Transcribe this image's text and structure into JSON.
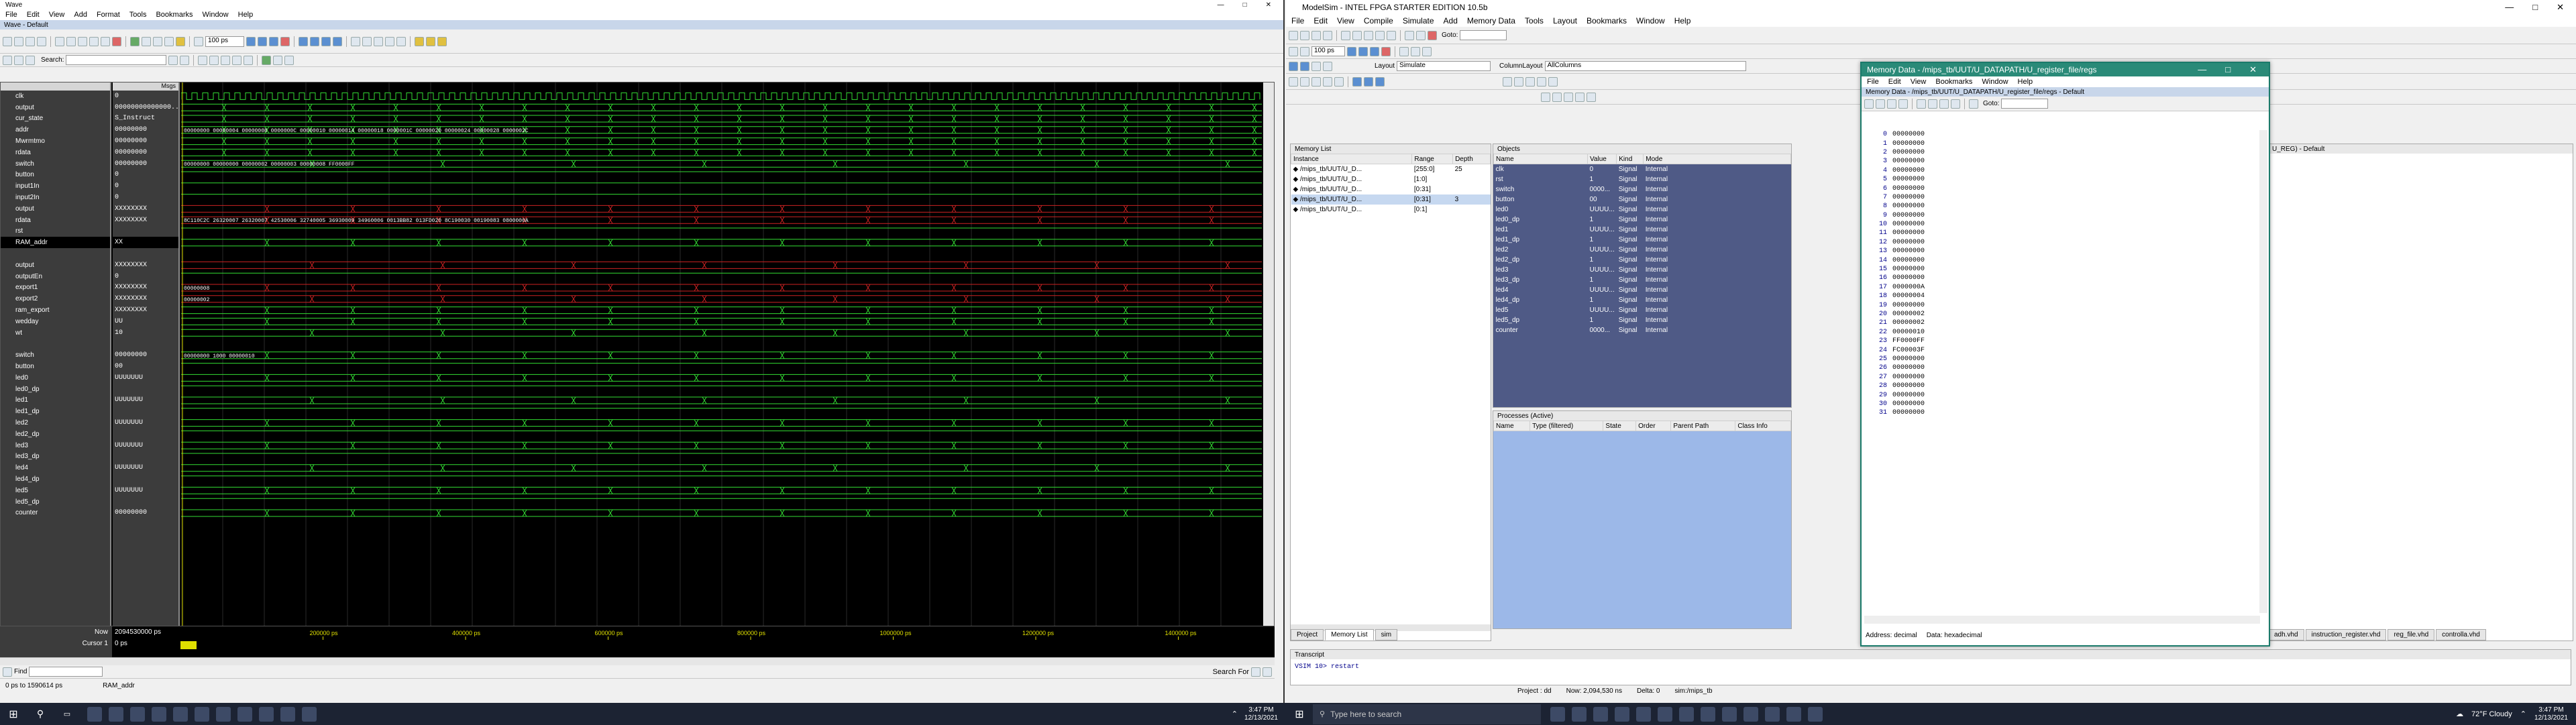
{
  "wave_window": {
    "title": "Wave",
    "subtitle": "Wave - Default",
    "menu": [
      "File",
      "Edit",
      "View",
      "Add",
      "Format",
      "Tools",
      "Bookmarks",
      "Window",
      "Help"
    ],
    "zoom_value": "100 ps",
    "search_label": "Search:",
    "msgs_header": "Msgs",
    "signals": [
      {
        "name": "clk",
        "value": "0"
      },
      {
        "name": "output",
        "value": "00000000000000..."
      },
      {
        "name": "cur_state",
        "value": "S_Instruct"
      },
      {
        "name": "addr",
        "value": "00000000"
      },
      {
        "name": "Mwrmtmo",
        "value": "00000000"
      },
      {
        "name": "rdata",
        "value": "00000000"
      },
      {
        "name": "switch",
        "value": "00000000"
      },
      {
        "name": "button",
        "value": "0"
      },
      {
        "name": "input1In",
        "value": "0"
      },
      {
        "name": "input2In",
        "value": "0"
      },
      {
        "name": "output",
        "value": "XXXXXXXX"
      },
      {
        "name": "rdata",
        "value": "XXXXXXXX"
      },
      {
        "name": "rst",
        "value": ""
      },
      {
        "name": "RAM_addr",
        "value": "XX"
      },
      {
        "name": "",
        "value": ""
      },
      {
        "name": "output",
        "value": "XXXXXXXX"
      },
      {
        "name": "outputEn",
        "value": "0"
      },
      {
        "name": "export1",
        "value": "XXXXXXXX"
      },
      {
        "name": "export2",
        "value": "XXXXXXXX"
      },
      {
        "name": "ram_export",
        "value": "XXXXXXXX"
      },
      {
        "name": "wedday",
        "value": "UU"
      },
      {
        "name": "wt",
        "value": "10"
      },
      {
        "name": "",
        "value": ""
      },
      {
        "name": "switch",
        "value": "00000000"
      },
      {
        "name": "button",
        "value": "00"
      },
      {
        "name": "led0",
        "value": "UUUUUUU"
      },
      {
        "name": "led0_dp",
        "value": ""
      },
      {
        "name": "led1",
        "value": "UUUUUUU"
      },
      {
        "name": "led1_dp",
        "value": ""
      },
      {
        "name": "led2",
        "value": "UUUUUUU"
      },
      {
        "name": "led2_dp",
        "value": ""
      },
      {
        "name": "led3",
        "value": "UUUUUUU"
      },
      {
        "name": "led3_dp",
        "value": ""
      },
      {
        "name": "led4",
        "value": "UUUUUUU"
      },
      {
        "name": "led4_dp",
        "value": ""
      },
      {
        "name": "led5",
        "value": "UUUUUUU"
      },
      {
        "name": "led5_dp",
        "value": ""
      },
      {
        "name": "counter",
        "value": "00000000"
      }
    ],
    "now_label": "Now",
    "now_value": "2094530000 ps",
    "cursor_label": "Cursor 1",
    "cursor_value": "0 ps",
    "timeline_labels": [
      "200000 ps",
      "400000 ps",
      "600000 ps",
      "800000 ps",
      "1000000 ps",
      "1200000 ps",
      "1400000 ps"
    ],
    "wave_texts": [
      "00000000  00000004  00000008  0000000C  00000010  00000014  00000018  0000001C  00000020  00000024  00000028  0000002C",
      "00000000  00000000  00000002  00000003  00000008  FF0000FF",
      "8C110C2C  26320007  26320007  42530006  32740005  36930009  34960006  0013BB82  013FD020  8C190030  00190083  0800000A",
      "00000008",
      "00000002",
      "00000000 1000  00000010"
    ],
    "find_label": "Find",
    "open_label": "Open",
    "search_for_label": "Search For",
    "status_range": "0 ps to 1590614 ps",
    "status_signal": "RAM_addr"
  },
  "modelsim": {
    "title": "ModelSim - INTEL FPGA STARTER EDITION 10.5b",
    "menu": [
      "File",
      "Edit",
      "View",
      "Compile",
      "Simulate",
      "Add",
      "Memory Data",
      "Tools",
      "Layout",
      "Bookmarks",
      "Window",
      "Help"
    ],
    "goto_label": "Goto:",
    "zoom_value": "100 ps",
    "layout_label": "Layout",
    "layout_value": "Simulate",
    "column_layout_label": "ColumnLayout",
    "column_layout_value": "AllColumns",
    "memory_list": {
      "title": "Memory List",
      "headers": [
        "Instance",
        "Range",
        "Depth"
      ],
      "rows": [
        {
          "instance": "/mips_tb/UUT/U_D...",
          "range": "[255:0]",
          "depth": "25"
        },
        {
          "instance": "/mips_tb/UUT/U_D...",
          "range": "[1:0]",
          "depth": ""
        },
        {
          "instance": "/mips_tb/UUT/U_D...",
          "range": "[0:31]",
          "depth": ""
        },
        {
          "instance": "/mips_tb/UUT/U_D...",
          "range": "[0:31]",
          "depth": "3"
        },
        {
          "instance": "/mips_tb/UUT/U_D...",
          "range": "[0:1]",
          "depth": ""
        }
      ],
      "tabs": [
        "Project",
        "Memory List",
        "sim"
      ]
    },
    "objects": {
      "title": "Objects",
      "headers": [
        "Name",
        "Value",
        "Kind",
        "Mode"
      ],
      "rows": [
        {
          "name": "clk",
          "value": "0",
          "kind": "Signal",
          "mode": "Internal"
        },
        {
          "name": "rst",
          "value": "1",
          "kind": "Signal",
          "mode": "Internal"
        },
        {
          "name": "switch",
          "value": "0000...",
          "kind": "Signal",
          "mode": "Internal"
        },
        {
          "name": "button",
          "value": "00",
          "kind": "Signal",
          "mode": "Internal"
        },
        {
          "name": "led0",
          "value": "UUUU...",
          "kind": "Signal",
          "mode": "Internal"
        },
        {
          "name": "led0_dp",
          "value": "1",
          "kind": "Signal",
          "mode": "Internal"
        },
        {
          "name": "led1",
          "value": "UUUU...",
          "kind": "Signal",
          "mode": "Internal"
        },
        {
          "name": "led1_dp",
          "value": "1",
          "kind": "Signal",
          "mode": "Internal"
        },
        {
          "name": "led2",
          "value": "UUUU...",
          "kind": "Signal",
          "mode": "Internal"
        },
        {
          "name": "led2_dp",
          "value": "1",
          "kind": "Signal",
          "mode": "Internal"
        },
        {
          "name": "led3",
          "value": "UUUU...",
          "kind": "Signal",
          "mode": "Internal"
        },
        {
          "name": "led3_dp",
          "value": "1",
          "kind": "Signal",
          "mode": "Internal"
        },
        {
          "name": "led4",
          "value": "UUUU...",
          "kind": "Signal",
          "mode": "Internal"
        },
        {
          "name": "led4_dp",
          "value": "1",
          "kind": "Signal",
          "mode": "Internal"
        },
        {
          "name": "led5",
          "value": "UUUU...",
          "kind": "Signal",
          "mode": "Internal"
        },
        {
          "name": "led5_dp",
          "value": "1",
          "kind": "Signal",
          "mode": "Internal"
        },
        {
          "name": "counter",
          "value": "0000...",
          "kind": "Signal",
          "mode": "Internal"
        }
      ]
    },
    "processes": {
      "title": "Processes (Active)",
      "headers": [
        "Name",
        "Type (filtered)",
        "State",
        "Order",
        "Parent Path",
        "Class Info"
      ]
    },
    "transcript": {
      "title": "Transcript",
      "line": "VSIM 10> restart"
    },
    "status": {
      "project": "Project : dd",
      "now": "Now: 2,094,530 ns",
      "delta": "Delta: 0",
      "path": "sim:/mips_tb"
    }
  },
  "memory_data": {
    "title": "Memory Data - /mips_tb/UUT/U_DATAPATH/U_register_file/regs",
    "inner_title": "Memory Data - /mips_tb/UUT/U_DATAPATH/U_register_file/regs - Default",
    "menu": [
      "File",
      "Edit",
      "View",
      "Bookmarks",
      "Window",
      "Help"
    ],
    "goto_label": "Goto:",
    "rows": [
      {
        "addr": "0",
        "value": "00000000"
      },
      {
        "addr": "1",
        "value": "00000000"
      },
      {
        "addr": "2",
        "value": "00000000"
      },
      {
        "addr": "3",
        "value": "00000000"
      },
      {
        "addr": "4",
        "value": "00000000"
      },
      {
        "addr": "5",
        "value": "00000000"
      },
      {
        "addr": "6",
        "value": "00000000"
      },
      {
        "addr": "7",
        "value": "00000000"
      },
      {
        "addr": "8",
        "value": "00000000"
      },
      {
        "addr": "9",
        "value": "00000000"
      },
      {
        "addr": "10",
        "value": "00000000"
      },
      {
        "addr": "11",
        "value": "00000000"
      },
      {
        "addr": "12",
        "value": "00000000"
      },
      {
        "addr": "13",
        "value": "00000000"
      },
      {
        "addr": "14",
        "value": "00000000"
      },
      {
        "addr": "15",
        "value": "00000000"
      },
      {
        "addr": "16",
        "value": "00000000"
      },
      {
        "addr": "17",
        "value": "0000000A"
      },
      {
        "addr": "18",
        "value": "00000004"
      },
      {
        "addr": "19",
        "value": "00000000"
      },
      {
        "addr": "20",
        "value": "00000002"
      },
      {
        "addr": "21",
        "value": "00000002"
      },
      {
        "addr": "22",
        "value": "00000010"
      },
      {
        "addr": "23",
        "value": "FF0000FF"
      },
      {
        "addr": "24",
        "value": "FC00003F"
      },
      {
        "addr": "25",
        "value": "00000000"
      },
      {
        "addr": "26",
        "value": "00000000"
      },
      {
        "addr": "27",
        "value": "00000000"
      },
      {
        "addr": "28",
        "value": "00000000"
      },
      {
        "addr": "29",
        "value": "00000000"
      },
      {
        "addr": "30",
        "value": "00000000"
      },
      {
        "addr": "31",
        "value": "00000000"
      }
    ],
    "status_address": "Address: decimal",
    "status_data": "Data: hexadecimal"
  },
  "right_strip": {
    "header": "U_REG) - Default",
    "tabs": [
      "adh.vhd",
      "instruction_register.vhd",
      "reg_file.vhd",
      "controlla.vhd"
    ]
  },
  "taskbar_left": {
    "time": "3:47 PM",
    "date": "12/13/2021"
  },
  "taskbar_right": {
    "search_placeholder": "Type here to search",
    "weather": "72°F  Cloudy",
    "time": "3:47 PM",
    "date": "12/13/2021"
  }
}
